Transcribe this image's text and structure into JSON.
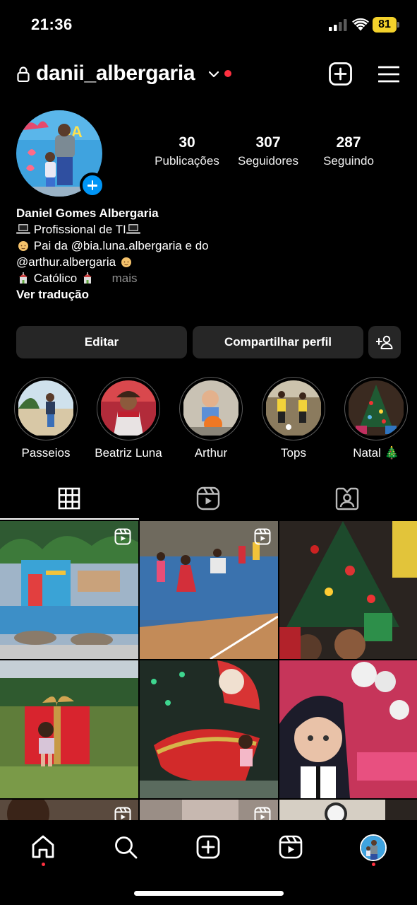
{
  "status_bar": {
    "time": "21:36",
    "battery": "81"
  },
  "header": {
    "username": "danii_albergaria"
  },
  "stats": [
    {
      "value": "30",
      "label": "Publicações"
    },
    {
      "value": "307",
      "label": "Seguidores"
    },
    {
      "value": "287",
      "label": "Seguindo"
    }
  ],
  "bio": {
    "name": "Daniel Gomes Albergaria",
    "line1": "Profissional de TI",
    "line2": "Pai da @bia.luna.albergaria e do",
    "line3": "@arthur.albergaria",
    "line4": "Católico",
    "more": "mais",
    "translate": "Ver tradução"
  },
  "buttons": {
    "edit": "Editar",
    "share": "Compartilhar perfil"
  },
  "highlights": [
    {
      "label": "Passeios"
    },
    {
      "label": "Beatriz Luna"
    },
    {
      "label": "Arthur"
    },
    {
      "label": "Tops"
    },
    {
      "label": "Natal 🎄"
    }
  ],
  "tabs": [
    "grid-icon",
    "reels-icon",
    "tagged-icon"
  ],
  "bottom_nav": [
    "home-icon",
    "search-icon",
    "create-icon",
    "reels-icon",
    "profile-avatar"
  ],
  "colors": {
    "accent_blue": "#0095f6",
    "notification_red": "#ff3040",
    "button_bg": "#262626",
    "battery_yellow": "#f3d12b"
  }
}
